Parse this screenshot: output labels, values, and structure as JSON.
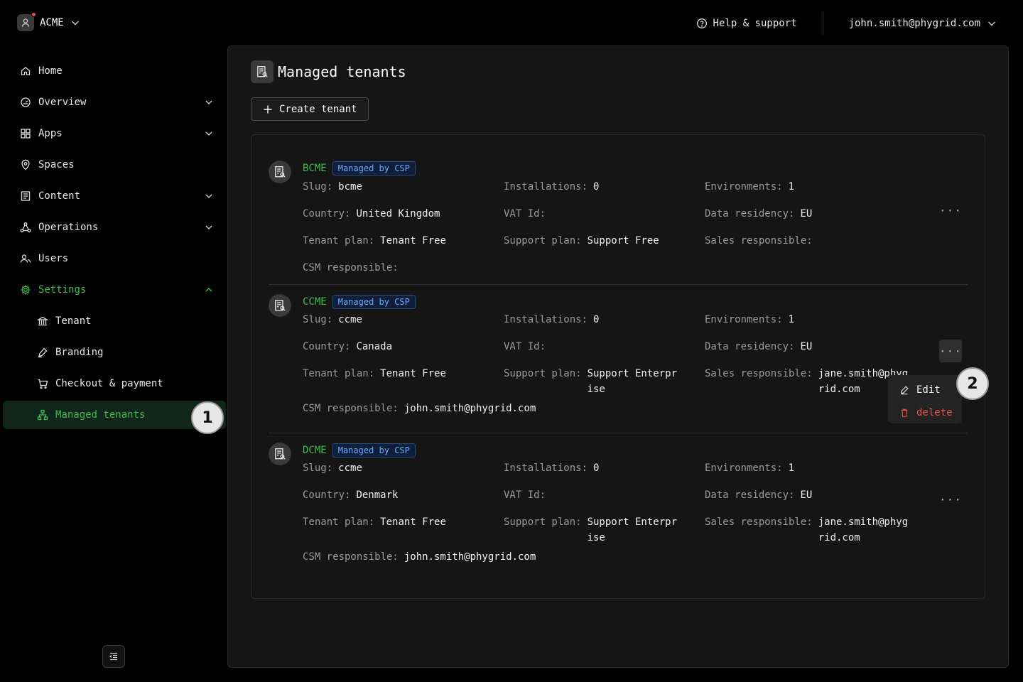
{
  "colors": {
    "accent": "#3fb950",
    "badge_text": "#6ea8ff",
    "danger": "#e5534b"
  },
  "org": {
    "name": "ACME",
    "icon": "user-icon"
  },
  "topbar": {
    "help_label": "Help & support",
    "user_email": "john.smith@phygrid.com"
  },
  "sidebar": {
    "items": [
      {
        "label": "Home",
        "icon": "home-icon"
      },
      {
        "label": "Overview",
        "icon": "gauge-icon"
      },
      {
        "label": "Apps",
        "icon": "grid-icon"
      },
      {
        "label": "Spaces",
        "icon": "map-pin-icon"
      },
      {
        "label": "Content",
        "icon": "file-icon"
      },
      {
        "label": "Operations",
        "icon": "network-icon"
      },
      {
        "label": "Users",
        "icon": "users-icon"
      },
      {
        "label": "Settings",
        "icon": "gear-icon"
      }
    ],
    "sub_items": [
      {
        "label": "Tenant",
        "icon": "bank-icon"
      },
      {
        "label": "Branding",
        "icon": "pen-icon"
      },
      {
        "label": "Checkout & payment",
        "icon": "cart-icon"
      },
      {
        "label": "Managed tenants",
        "icon": "hierarchy-icon"
      }
    ]
  },
  "callouts": [
    "1",
    "2"
  ],
  "main": {
    "title": "Managed tenants",
    "create_label": "Create tenant"
  },
  "labels": {
    "slug": "Slug:",
    "installations": "Installations:",
    "environments": "Environments:",
    "country": "Country:",
    "vat": "VAT Id:",
    "residency": "Data residency:",
    "tenant_plan": "Tenant plan:",
    "support_plan": "Support plan:",
    "sales": "Sales responsible:",
    "csm": "CSM responsible:"
  },
  "tenants": [
    {
      "name": "BCME",
      "badge": "Managed by CSP",
      "slug": "bcme",
      "installations": "0",
      "environments": "1",
      "country": "United Kingdom",
      "vat": "",
      "residency": "EU",
      "tenant_plan": "Tenant Free",
      "support_plan": "Support Free",
      "sales": "",
      "csm": ""
    },
    {
      "name": "CCME",
      "badge": "Managed by CSP",
      "slug": "ccme",
      "installations": "0",
      "environments": "1",
      "country": "Canada",
      "vat": "",
      "residency": "EU",
      "tenant_plan": "Tenant Free",
      "support_plan": "Support Enterprise",
      "sales": "jane.smith@phygrid.com",
      "csm": "john.smith@phygrid.com"
    },
    {
      "name": "DCME",
      "badge": "Managed by CSP",
      "slug": "ccme",
      "installations": "0",
      "environments": "1",
      "country": "Denmark",
      "vat": "",
      "residency": "EU",
      "tenant_plan": "Tenant Free",
      "support_plan": "Support Enterprise",
      "sales": "jane.smith@phygrid.com",
      "csm": "john.smith@phygrid.com"
    }
  ],
  "menu": {
    "more_label": "···",
    "edit_label": "Edit",
    "delete_label": "delete"
  }
}
